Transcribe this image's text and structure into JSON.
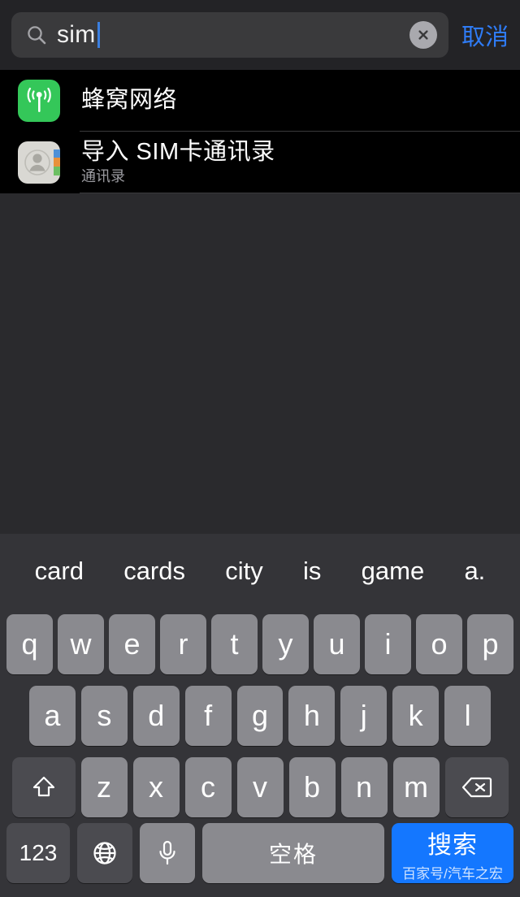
{
  "search": {
    "icon": "search-icon",
    "value": "sim",
    "placeholder": "搜索",
    "clear_icon": "clear-circle-icon",
    "cancel_label": "取消",
    "cursor_color": "#3b7fe0",
    "accent_color": "#2f7cf6"
  },
  "results": [
    {
      "icon": "cellular-icon",
      "icon_color": "#34c759",
      "title": "蜂窝网络",
      "subtitle": ""
    },
    {
      "icon": "contacts-icon",
      "icon_color": "#d8d7d2",
      "title": "导入 SIM卡通讯录",
      "subtitle": "通讯录"
    }
  ],
  "keyboard": {
    "suggestions": [
      "card",
      "cards",
      "city",
      "is",
      "game",
      "a."
    ],
    "row1": [
      "q",
      "w",
      "e",
      "r",
      "t",
      "y",
      "u",
      "i",
      "o",
      "p"
    ],
    "row2": [
      "a",
      "s",
      "d",
      "f",
      "g",
      "h",
      "j",
      "k",
      "l"
    ],
    "row3_letters": [
      "z",
      "x",
      "c",
      "v",
      "b",
      "n",
      "m"
    ],
    "shift_icon": "shift-arrow-icon",
    "backspace_icon": "backspace-icon",
    "numeric_label": "123",
    "globe_icon": "globe-icon",
    "mic_icon": "microphone-icon",
    "space_label": "空格",
    "search_label": "搜索",
    "search_key_color": "#1477ff"
  },
  "watermark": "百家号/汽车之宏"
}
